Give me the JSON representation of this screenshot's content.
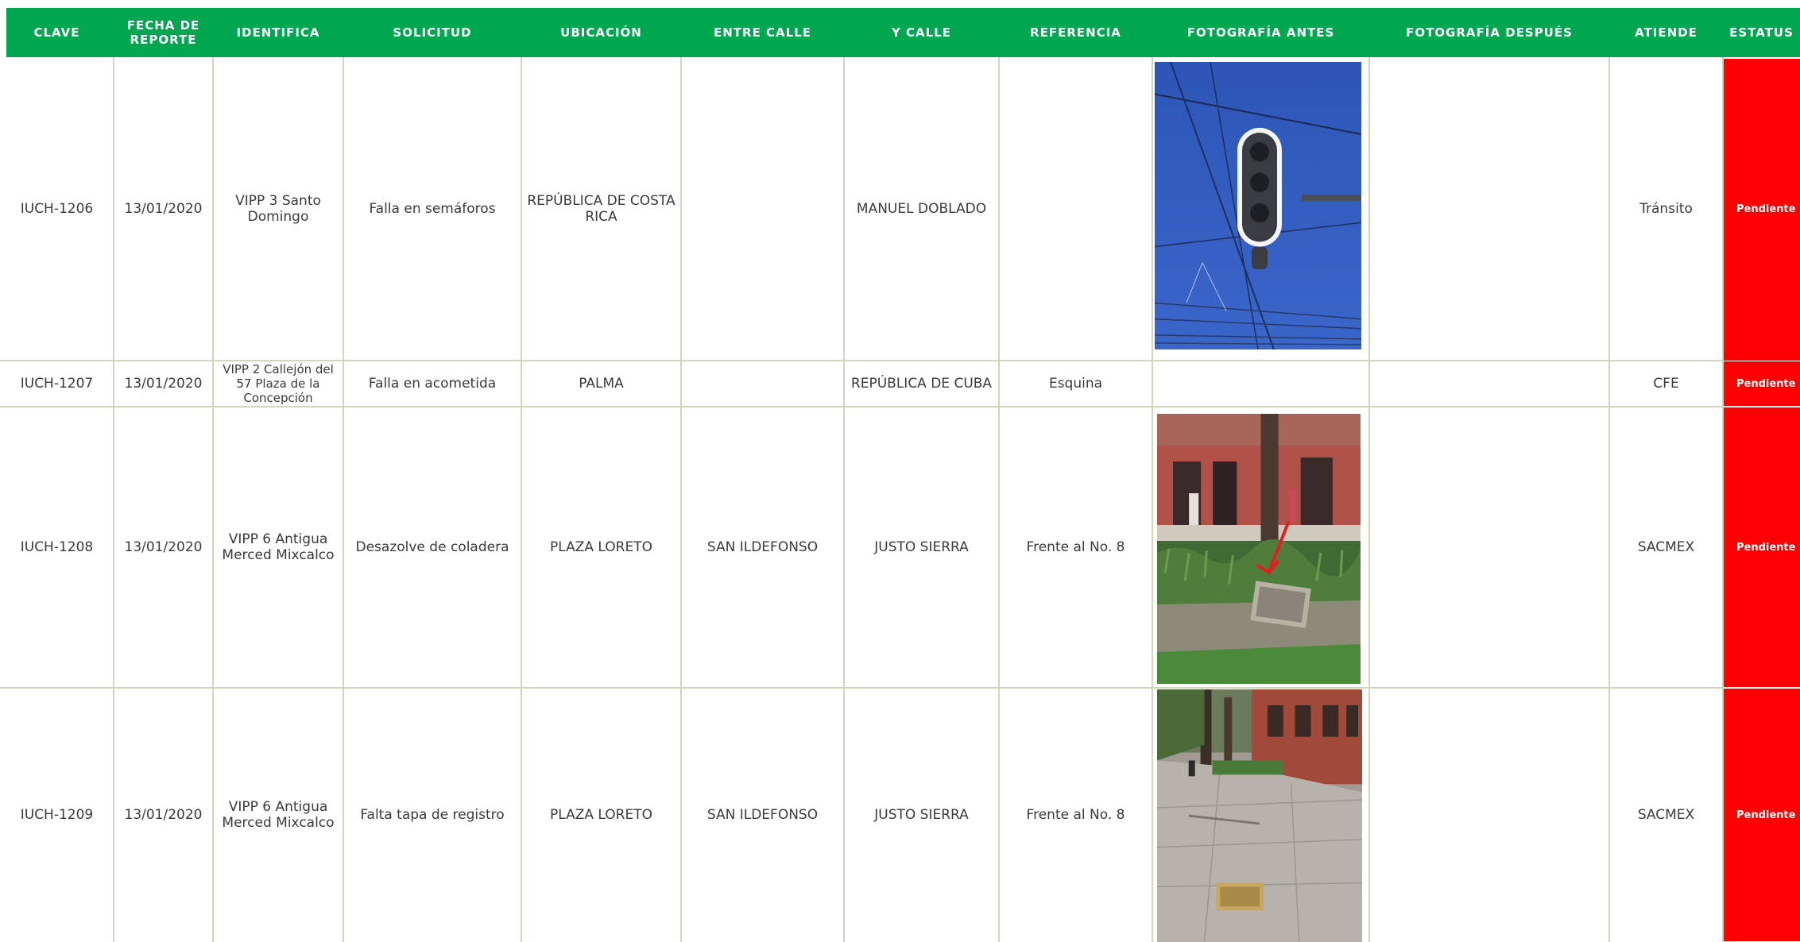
{
  "header": {
    "bg_color": "#00a650",
    "columns": [
      "CLAVE",
      "FECHA DE REPORTE",
      "IDENTIFICA",
      "SOLICITUD",
      "UBICACIÓN",
      "ENTRE CALLE",
      "Y CALLE",
      "REFERENCIA",
      "FOTOGRAFÍA ANTES",
      "FOTOGRAFÍA DESPUÉS",
      "ATIENDE",
      "ESTATUS"
    ]
  },
  "rows": [
    {
      "clave": "IUCH-1206",
      "fecha": "13/01/2020",
      "identifica": "VIPP 3 Santo Domingo",
      "solicitud": "Falla en semáforos",
      "ubicacion": "REPÚBLICA DE COSTA RICA",
      "entre_calle": "",
      "y_calle": "MANUEL DOBLADO",
      "referencia": "",
      "foto_antes": "traffic-light-photo",
      "foto_despues": "",
      "atiende": "Tránsito",
      "estatus": "Pendiente"
    },
    {
      "clave": "IUCH-1207",
      "fecha": "13/01/2020",
      "identifica": "VIPP 2 Callejón del 57 Plaza de la Concepción",
      "solicitud": "Falla en acometida",
      "ubicacion": "PALMA",
      "entre_calle": "",
      "y_calle": "REPÚBLICA DE CUBA",
      "referencia": "Esquina",
      "foto_antes": "",
      "foto_despues": "",
      "atiende": "CFE",
      "estatus": "Pendiente"
    },
    {
      "clave": "IUCH-1208",
      "fecha": "13/01/2020",
      "identifica": "VIPP 6 Antigua Merced Mixcalco",
      "solicitud": "Desazolve de coladera",
      "ubicacion": "PLAZA LORETO",
      "entre_calle": "SAN ILDEFONSO",
      "y_calle": "JUSTO SIERRA",
      "referencia": "Frente al No. 8",
      "foto_antes": "plaza-drain-photo",
      "foto_despues": "",
      "atiende": "SACMEX",
      "estatus": "Pendiente"
    },
    {
      "clave": "IUCH-1209",
      "fecha": "13/01/2020",
      "identifica": "VIPP 6 Antigua Merced Mixcalco",
      "solicitud": "Falta tapa de registro",
      "ubicacion": "PLAZA LORETO",
      "entre_calle": "SAN ILDEFONSO",
      "y_calle": "JUSTO SIERRA",
      "referencia": "Frente al No. 8",
      "foto_antes": "sidewalk-photo",
      "foto_despues": "",
      "atiende": "SACMEX",
      "estatus": "Pendiente"
    }
  ],
  "colors": {
    "status_pending": "#ff0000",
    "grid_line": "#cfd7b8"
  }
}
